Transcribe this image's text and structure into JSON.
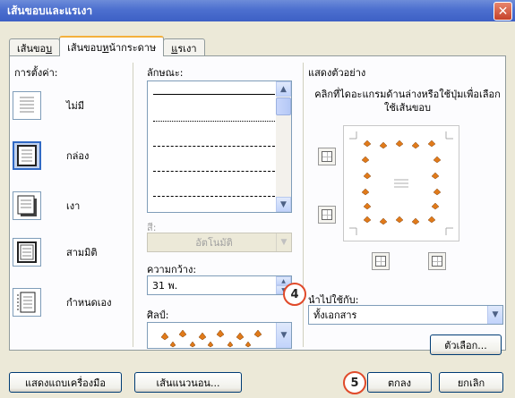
{
  "window": {
    "title": "เส้นขอบและแรเงา",
    "close_glyph": "✕"
  },
  "tabs": [
    {
      "label_pre": "เส้นขอ",
      "label_u": "บ",
      "label_post": ""
    },
    {
      "label_pre": "เส้นขอบ",
      "label_u": "ห",
      "label_post": "น้ากระดาษ"
    },
    {
      "label_pre": "",
      "label_u": "แ",
      "label_post": "รเงา"
    }
  ],
  "setting": {
    "header": "การตั้งค่า:",
    "items": [
      {
        "label": "ไม่มี"
      },
      {
        "label": "กล่อง"
      },
      {
        "label": "เงา"
      },
      {
        "label": "สามมิติ"
      },
      {
        "label": "กำหนดเอง"
      }
    ]
  },
  "style": {
    "header": "ลักษณะ:",
    "color_label": "สี:",
    "color_value": "อัตโนมัติ",
    "width_label": "ความกว้าง:",
    "width_value": "31 พ.",
    "art_label": "ศิลป์:"
  },
  "preview": {
    "header": "แสดงตัวอย่าง",
    "instruction": "คลิกที่ไดอะแกรมด้านล่างหรือใช้ปุ่มเพื่อเลือกใช้เส้นขอบ",
    "apply_label": "นำไปใช้กับ:",
    "apply_value": "ทั้งเอกสาร",
    "options_button": "ตัวเลือก..."
  },
  "footer": {
    "toolbar_button": "แสดงแถบเครื่องมือ",
    "horizontal_button": "เส้นแนวนอน...",
    "ok_button": "ตกลง",
    "cancel_button": "ยกเลิก"
  },
  "callouts": {
    "four": "4",
    "five": "5"
  },
  "colors": {
    "title_bar": "#3d60c5",
    "callout_border": "#e04a2a",
    "selected": "#316ac5",
    "butterfly": "#e07a1a"
  }
}
